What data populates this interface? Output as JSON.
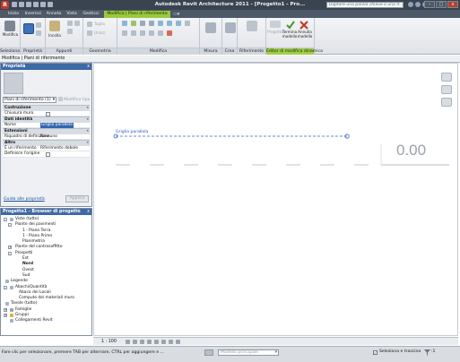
{
  "titlebar": {
    "title": "Autodesk Revit Architecture 2011 - [Progetto1 - Pro...",
    "search_placeholder": "Digitare una parola chiave o una fr...",
    "minimize": "–",
    "maximize": "□",
    "close": "x"
  },
  "tabs": [
    "Inizio",
    "Inserisci",
    "Annota",
    "Vista",
    "Gestisci",
    "Modifica | Piani di riferimento"
  ],
  "ribbon": {
    "panels": {
      "selection": "Seleziona",
      "properties": "Proprietà",
      "clipboard": "Appunti",
      "geometry": "Geometria",
      "modify": "Modifica",
      "measure": "Misura",
      "create": "Crea",
      "reference": "Riferimento",
      "dynamic_editor": "Editor di modifica dinamica"
    },
    "buttons": {
      "modify": "Modifica",
      "paste": "Incolla",
      "cut": "Taglia",
      "join": "Unisci",
      "reference_label": "Riferimento",
      "project_label": "Progetto",
      "finish_model": "Termina modello",
      "cancel_model": "Annulla modello"
    }
  },
  "option_bar": {
    "text": "Modifica | Piani di riferimento"
  },
  "properties": {
    "title": "Proprietà",
    "close": "x",
    "type": "Piani di riferimento (1)",
    "edit_type": "Modifica tipo",
    "categories": [
      "Costruzione",
      "Dati identità",
      "Estensioni",
      "Altro"
    ],
    "rows": {
      "wall_closure": "Chiusura muro",
      "name_key": "Nome",
      "name_value": "Griglia parallela",
      "scope_box_key": "Riquadro di definizione",
      "scope_box_value": "Nessuno",
      "is_reference_key": "È un riferimento",
      "is_reference_value": "Riferimento debole",
      "defines_origin_key": "Definisce l'origine"
    },
    "help_link": "Guida alle proprietà",
    "apply": "Applica"
  },
  "browser": {
    "title": "Progetto1 - Browser di progetto",
    "close": "x",
    "nodes": {
      "views": "Viste (tutto)",
      "floor_plans": "Piante dei pavimenti",
      "level1": "1 - Piano Terra",
      "level2": "1 - Piano Primo",
      "site": "Planimetria",
      "ceiling_plans": "Piante del controsoffitto",
      "elevations": "Prospetti",
      "east": "Est",
      "north": "Nord",
      "west": "Ovest",
      "south": "Sud",
      "legends": "Legende",
      "schedules": "Abachi/Quantità",
      "room_schedule": "Abaco dei Locali",
      "wall_takeoff": "Computo dei materiali muro",
      "sheets": "Tavole (tutto)",
      "families": "Famiglie",
      "groups": "Gruppi",
      "revit_links": "Collegamenti Revit"
    }
  },
  "canvas": {
    "reference_label": "Griglia parallela",
    "level_value": "0.00"
  },
  "viewbar": {
    "scale": "1 : 100"
  },
  "statusbar": {
    "message": "Fare clic per selezionare, premere TAB per alternare, CTRL per aggiungere e ...",
    "model": "Modello principale",
    "drag_label": "Seleziona e trascina",
    "filter_count": ":1"
  },
  "colors": {
    "titlebar": "#3a4350",
    "context_tab": "#9aca3c",
    "palette_header": "#3d69a6",
    "reference_plane": "#2a55c0"
  }
}
